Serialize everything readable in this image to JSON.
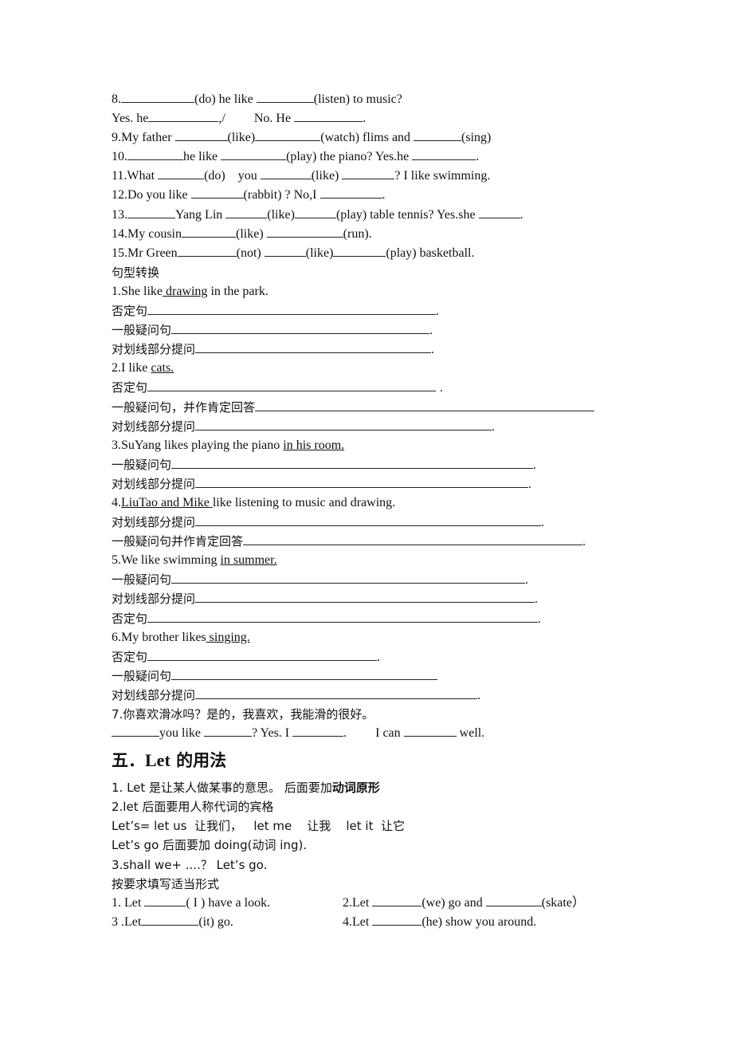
{
  "exercises_fill": {
    "q8a": {
      "n": "8.",
      "p1": "(do) he like ",
      "p2": "(listen) to music?"
    },
    "q8b": {
      "p1": "Yes. he",
      "p2": ",/",
      "p3": "No. He ",
      "p4": "."
    },
    "q9": {
      "p1": "9.My father ",
      "p2": "(like)",
      "p3": "(watch) flims and ",
      "p4": "(sing)"
    },
    "q10": {
      "p1": "10.",
      "p2": "he like ",
      "p3": "(play) the piano? Yes.he ",
      "p4": "."
    },
    "q11": {
      "p1": "11.What ",
      "p2": "(do)    you ",
      "p3": "(like) ",
      "p4": "? I like swimming."
    },
    "q12": {
      "p1": "12.Do you like ",
      "p2": "(rabbit) ? No,I ",
      "p3": "."
    },
    "q13": {
      "p1": "13.",
      "p2": "Yang Lin ",
      "p3": "(like)",
      "p4": "(play) table tennis? Yes.she ",
      "p5": "."
    },
    "q14": {
      "p1": "14.My cousin",
      "p2": "(like) ",
      "p3": "(run)."
    },
    "q15": {
      "p1": "15.Mr Green",
      "p2": "(not) ",
      "p3": "(like)",
      "p4": "(play) basketball."
    }
  },
  "transform": {
    "title": "句型转换",
    "s1": {
      "pre": "1.She like",
      "u": " drawing",
      "post": " in the park."
    },
    "s2": {
      "pre": "2.I like ",
      "u": "cats.",
      "post": ""
    },
    "s3": {
      "pre": "3.SuYang likes playing the piano ",
      "u": "in his room.",
      "post": ""
    },
    "s4": {
      "pre": "4.",
      "u": "LiuTao and Mike ",
      "post": "like listening to music and drawing."
    },
    "s5": {
      "pre": "5.We like swimming ",
      "u": "in summer.",
      "post": ""
    },
    "s6": {
      "pre": "6.My brother likes",
      "u": " singing.",
      "post": ""
    },
    "s7": {
      "cn": "7.你喜欢滑冰吗？是的，我喜欢，我能滑的很好。",
      "p1": "you like ",
      "p2": "? Yes. I ",
      "p3": ".",
      "p4": "I can ",
      "p5": " well."
    },
    "labels": {
      "neg": "否定句",
      "q": "一般疑问句",
      "ask": "对划线部分提问",
      "q_yes_comma": "一般疑问句，并作肯定回答",
      "q_yes": "一般疑问句并作肯定回答"
    },
    "dot": "."
  },
  "section5": {
    "heading_num": "五．",
    "heading_en": "Let",
    "heading_cn": " 的用法",
    "l1_pre": "1. Let 是让某人做某事的意思。  后面要加",
    "l1_bold": "动词原形",
    "l2": "2.let  后面要用人称代词的宾格",
    "l3": "Let’s= let us  让我们，   let me    让我    let it  让它",
    "l4": "Let’s go  后面要加 doing(动词 ing).",
    "l5": "3.shall we+ ....？  Let’s go.",
    "l6": "按要求填写适当形式",
    "e1": {
      "p1": "1. Let ",
      "p2": "( I ) have a look."
    },
    "e2": {
      "p1": "2.Let ",
      "p2": "(we) go and ",
      "p3": "(skate）"
    },
    "e3": {
      "p1": "3 .Let",
      "p2": "(it) go."
    },
    "e4": {
      "p1": "4.Let ",
      "p2": "(he) show you around."
    }
  }
}
